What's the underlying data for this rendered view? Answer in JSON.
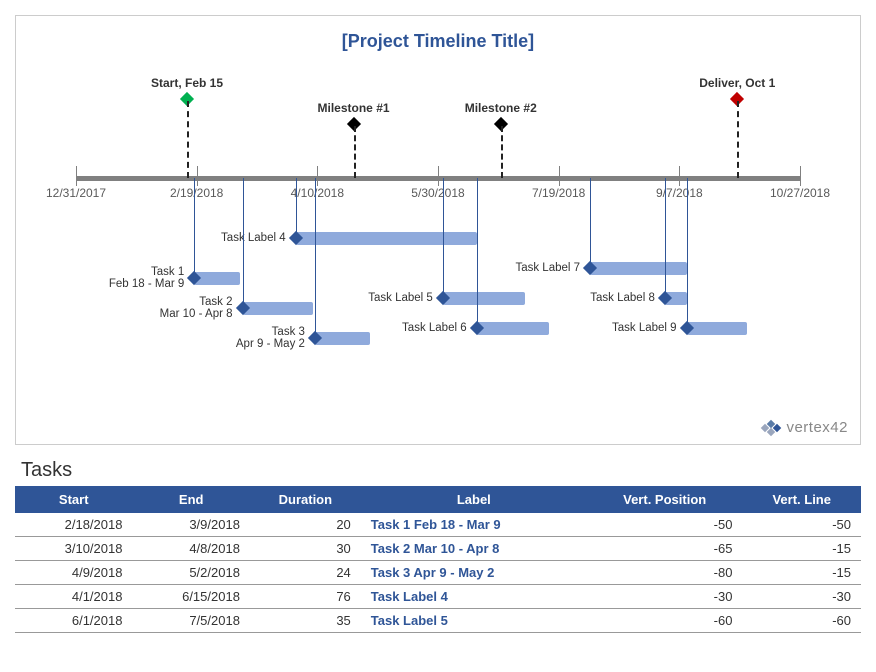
{
  "chart_data": {
    "type": "gantt",
    "title": "[Project Timeline Title]",
    "x_axis": {
      "min": "12/31/2017",
      "max": "10/27/2018",
      "ticks": [
        "12/31/2017",
        "2/19/2018",
        "4/10/2018",
        "5/30/2018",
        "7/19/2018",
        "9/7/2018",
        "10/27/2018"
      ]
    },
    "milestones": [
      {
        "label": "Start, Feb 15",
        "date": "2/15/2018",
        "color": "green",
        "tall": true
      },
      {
        "label": "Milestone #1",
        "date": "4/25/2018",
        "color": "black",
        "tall": false
      },
      {
        "label": "Milestone #2",
        "date": "6/25/2018",
        "color": "black",
        "tall": false
      },
      {
        "label": "Deliver, Oct 1",
        "date": "10/1/2018",
        "color": "red",
        "tall": true
      }
    ],
    "tasks": [
      {
        "label": "Task Label 4",
        "start": "4/1/2018",
        "end": "6/15/2018",
        "vpos": -30
      },
      {
        "label": "Task 1\nFeb 18 - Mar 9",
        "start": "2/18/2018",
        "end": "3/9/2018",
        "vpos": -50
      },
      {
        "label": "Task Label 7",
        "start": "8/1/2018",
        "end": "9/10/2018",
        "vpos": -45
      },
      {
        "label": "Task Label 5",
        "start": "6/1/2018",
        "end": "7/5/2018",
        "vpos": -60
      },
      {
        "label": "Task Label 8",
        "start": "9/1/2018",
        "end": "9/10/2018",
        "vpos": -60
      },
      {
        "label": "Task 2\nMar 10 - Apr 8",
        "start": "3/10/2018",
        "end": "4/8/2018",
        "vpos": -65
      },
      {
        "label": "Task Label 6",
        "start": "6/15/2018",
        "end": "7/15/2018",
        "vpos": -75
      },
      {
        "label": "Task Label 9",
        "start": "9/10/2018",
        "end": "10/5/2018",
        "vpos": -75
      },
      {
        "label": "Task 3\nApr 9 - May 2",
        "start": "4/9/2018",
        "end": "5/2/2018",
        "vpos": -80
      }
    ]
  },
  "brand": "vertex42",
  "table": {
    "title": "Tasks",
    "headers": [
      "Start",
      "End",
      "Duration",
      "Label",
      "Vert. Position",
      "Vert. Line"
    ],
    "rows": [
      {
        "start": "2/18/2018",
        "end": "3/9/2018",
        "duration": 20,
        "label": "Task 1  Feb 18 - Mar 9",
        "vpos": -50,
        "vline": -50
      },
      {
        "start": "3/10/2018",
        "end": "4/8/2018",
        "duration": 30,
        "label": "Task 2  Mar 10 - Apr 8",
        "vpos": -65,
        "vline": -15
      },
      {
        "start": "4/9/2018",
        "end": "5/2/2018",
        "duration": 24,
        "label": "Task 3  Apr 9 - May 2",
        "vpos": -80,
        "vline": -15
      },
      {
        "start": "4/1/2018",
        "end": "6/15/2018",
        "duration": 76,
        "label": "Task Label 4",
        "vpos": -30,
        "vline": -30
      },
      {
        "start": "6/1/2018",
        "end": "7/5/2018",
        "duration": 35,
        "label": "Task Label 5",
        "vpos": -60,
        "vline": -60
      }
    ]
  }
}
